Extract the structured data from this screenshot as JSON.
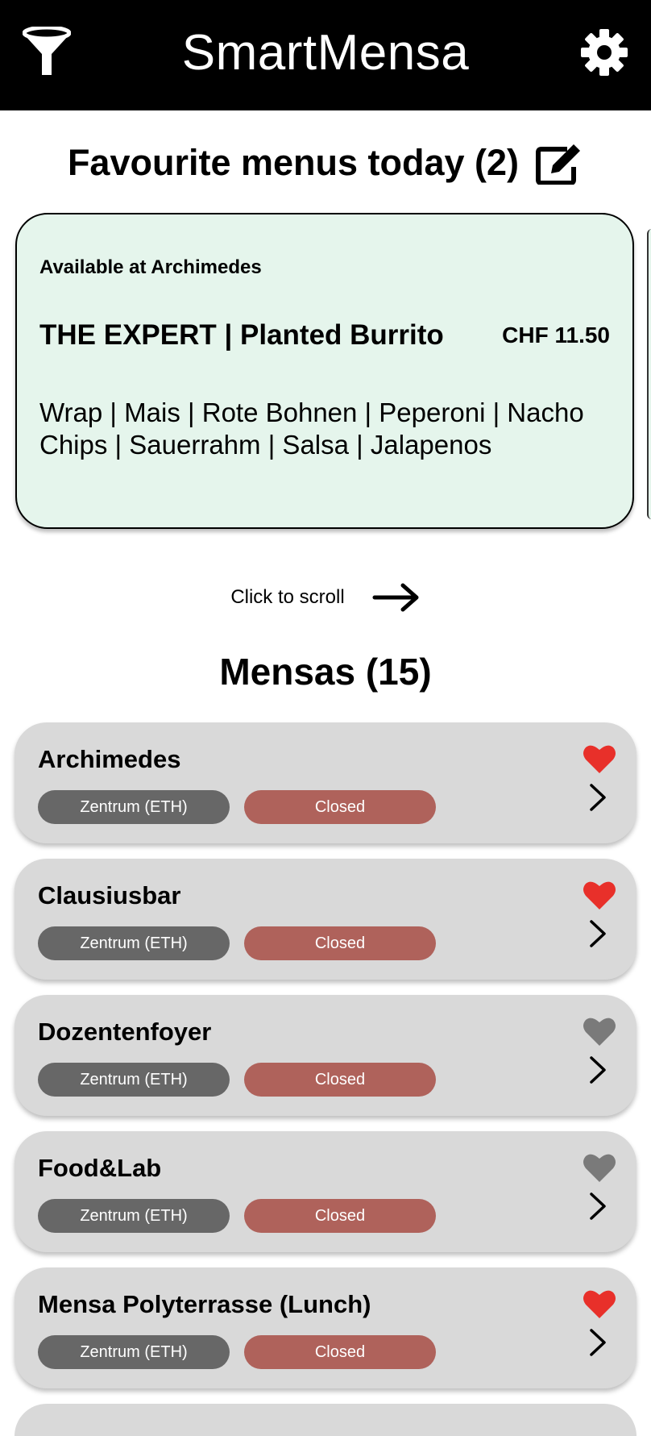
{
  "app": {
    "title": "SmartMensa"
  },
  "favourites": {
    "heading": "Favourite menus today (2)",
    "card": {
      "available": "Available at Archimedes",
      "menu_name": "THE EXPERT | Planted Burrito",
      "price": "CHF 11.50",
      "description": "Wrap | Mais | Rote Bohnen | Peperoni | Nacho Chips | Sauerrahm | Salsa | Jalapenos"
    },
    "scroll_hint": "Click to scroll"
  },
  "mensas": {
    "heading": "Mensas (15)",
    "items": [
      {
        "name": "Archimedes",
        "location": "Zentrum (ETH)",
        "status": "Closed",
        "favourite": true
      },
      {
        "name": "Clausiusbar",
        "location": "Zentrum (ETH)",
        "status": "Closed",
        "favourite": true
      },
      {
        "name": "Dozentenfoyer",
        "location": "Zentrum (ETH)",
        "status": "Closed",
        "favourite": false
      },
      {
        "name": "Food&Lab",
        "location": "Zentrum (ETH)",
        "status": "Closed",
        "favourite": false
      },
      {
        "name": "Mensa Polyterrasse (Lunch)",
        "location": "Zentrum (ETH)",
        "status": "Closed",
        "favourite": true
      }
    ]
  },
  "icons": {
    "filter": "filter-icon",
    "settings": "gear-icon",
    "edit": "edit-icon",
    "scroll": "arrow-right-icon",
    "favourite": "heart-icon",
    "open": "chevron-right-icon"
  },
  "colors": {
    "topbar": "#000000",
    "favourite_card": "#e5f5ec",
    "mensa_card": "#d9d9d9",
    "location_pill": "#676767",
    "status_closed": "#af625b",
    "heart_active": "#e8302a",
    "heart_inactive": "#7a7a7a"
  }
}
